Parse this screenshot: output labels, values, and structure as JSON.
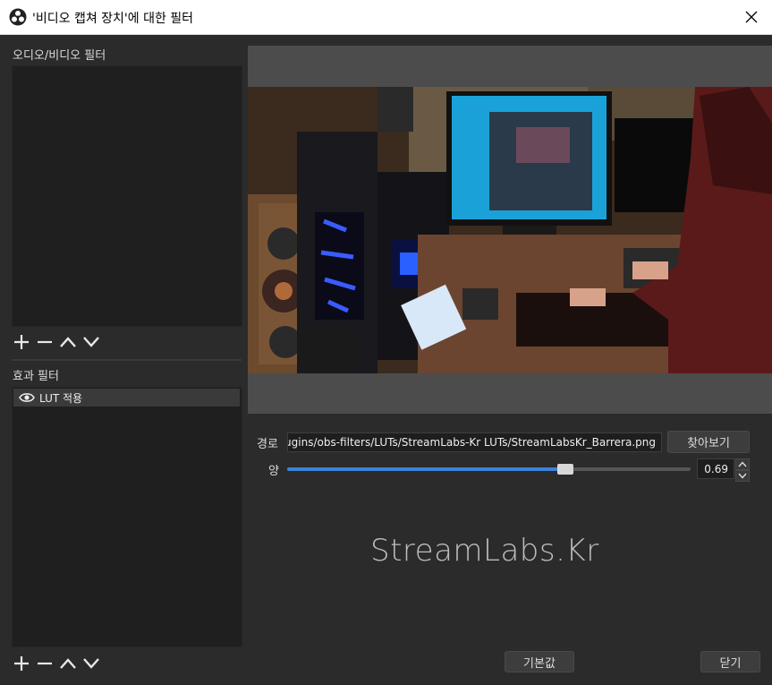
{
  "window": {
    "title": "'비디오 캡쳐 장치'에 대한 필터"
  },
  "audio_video_filters": {
    "label": "오디오/비디오 필터",
    "items": []
  },
  "effect_filters": {
    "label": "효과 필터",
    "items": [
      {
        "name": "LUT 적용",
        "visible": true
      }
    ]
  },
  "settings": {
    "path_label": "경로",
    "path_value": "C:/Program Files/obs-studio/data/obs-plugins/obs-filters/LUTs/StreamLabs-Kr LUTs/StreamLabsKr_Barrera.png",
    "browse_label": "찾아보기",
    "amount_label": "양",
    "amount_value": "0.69",
    "amount_fraction": 0.69
  },
  "watermark": "StreamLabs.Kr",
  "buttons": {
    "defaults": "기본값",
    "close": "닫기"
  },
  "colors": {
    "accent": "#3c82d8",
    "panel": "#2b2b2b",
    "list": "#1f1f1f"
  }
}
